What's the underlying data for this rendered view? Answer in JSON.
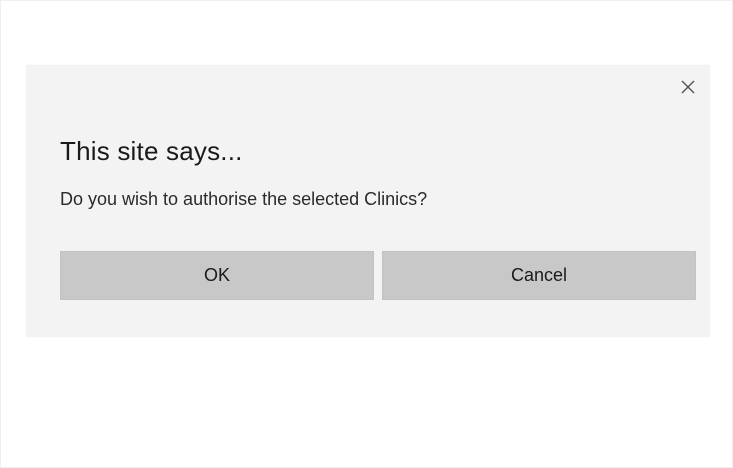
{
  "dialog": {
    "title": "This site says...",
    "message": "Do you wish to authorise the selected Clinics?",
    "close_icon": "close-icon",
    "buttons": {
      "ok_label": "OK",
      "cancel_label": "Cancel"
    }
  },
  "colors": {
    "dialog_background": "#f3f3f3",
    "button_background": "#c8c8c8",
    "text": "#1a1a1a"
  }
}
